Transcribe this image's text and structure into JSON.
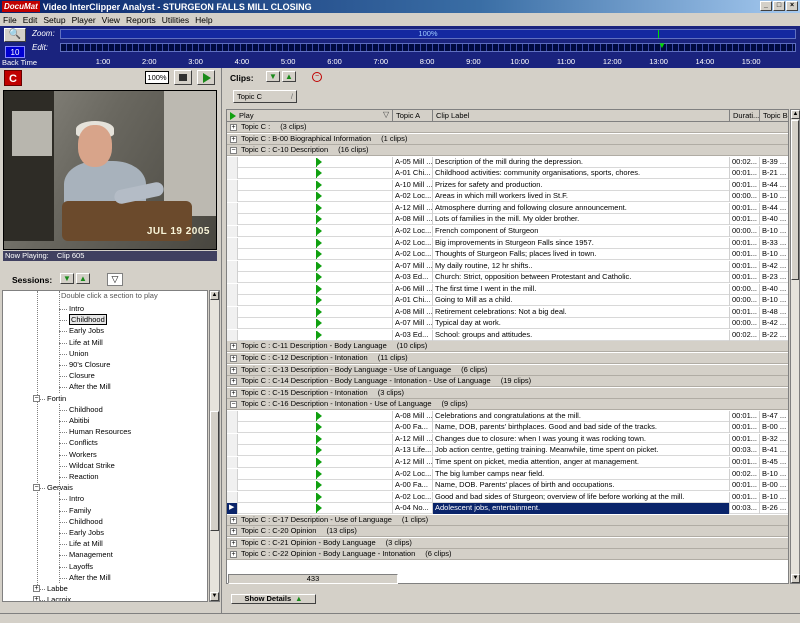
{
  "title_bar": {
    "logo": "DocuMat",
    "app": "Video InterClipper Analyst",
    "separator": "-",
    "document": "STURGEON FALLS MILL CLOSING",
    "controls": [
      "_",
      "□",
      "×"
    ]
  },
  "menu": [
    "File",
    "Edit",
    "Setup",
    "Player",
    "View",
    "Reports",
    "Utilities",
    "Help"
  ],
  "timeline": {
    "zoom_label": "Zoom:",
    "edit_label": "Edit:",
    "zoom_value": "100%",
    "back_time_value": "10",
    "back_time_label": "Back Time",
    "ticks": [
      "1:00",
      "2:00",
      "3:00",
      "4:00",
      "5:00",
      "6:00",
      "7:00",
      "8:00",
      "9:00",
      "10:00",
      "11:00",
      "12:00",
      "13:00",
      "14:00",
      "15:00"
    ],
    "edit_position_minutes": 13.0
  },
  "player": {
    "zoom": "100%",
    "video_timestamp": "JUL 19 2005",
    "now_playing_label": "Now Playing:",
    "now_playing_value": "Clip 605"
  },
  "sessions": {
    "label": "Sessions:",
    "hint": "Double click a section to play",
    "tree": [
      {
        "label": "Intro",
        "level": 2
      },
      {
        "label": "Childhood",
        "level": 2,
        "selected": true
      },
      {
        "label": "Early Jobs",
        "level": 2
      },
      {
        "label": "Life at Mill",
        "level": 2
      },
      {
        "label": "Union",
        "level": 2
      },
      {
        "label": "90's Closure",
        "level": 2
      },
      {
        "label": "Closure",
        "level": 2
      },
      {
        "label": "After the Mill",
        "level": 2
      },
      {
        "label": "Fortin",
        "level": 1,
        "expanded": true
      },
      {
        "label": "Childhood",
        "level": 2
      },
      {
        "label": "Abitibi",
        "level": 2
      },
      {
        "label": "Human Resources",
        "level": 2
      },
      {
        "label": "Conflicts",
        "level": 2
      },
      {
        "label": "Workers",
        "level": 2
      },
      {
        "label": "Wildcat Strike",
        "level": 2
      },
      {
        "label": "Reaction",
        "level": 2
      },
      {
        "label": "Gervais",
        "level": 1,
        "expanded": true
      },
      {
        "label": "Intro",
        "level": 2
      },
      {
        "label": "Family",
        "level": 2
      },
      {
        "label": "Childhood",
        "level": 2
      },
      {
        "label": "Early Jobs",
        "level": 2
      },
      {
        "label": "Life at Mill",
        "level": 2
      },
      {
        "label": "Management",
        "level": 2
      },
      {
        "label": "Layoffs",
        "level": 2
      },
      {
        "label": "After the Mill",
        "level": 2
      },
      {
        "label": "Labbe",
        "level": 1,
        "expanded": false
      },
      {
        "label": "Lacroix",
        "level": 1,
        "expanded": false
      }
    ]
  },
  "clips": {
    "label": "Clips:",
    "group_by": "Topic C",
    "columns": [
      "Play",
      "Topic A",
      "Clip Label",
      "Durati...",
      "Topic B"
    ],
    "rows": [
      {
        "type": "group",
        "text": "Topic C :",
        "count": "(3 clips)",
        "expanded": false
      },
      {
        "type": "group",
        "text": "Topic C : B-00 Biographical Information",
        "count": "(1 clips)",
        "expanded": false
      },
      {
        "type": "group",
        "text": "Topic C : C-10 Description",
        "count": "(16 clips)",
        "expanded": true
      },
      {
        "type": "clip",
        "topic_a": "A-05 Mill ...",
        "label": "Description of the mill during the depression.",
        "dur": "00:02...",
        "topic_b": "B-39 ..."
      },
      {
        "type": "clip",
        "topic_a": "A-01 Chi...",
        "label": "Childhood activities: community organisations, sports, chores.",
        "dur": "00:01...",
        "topic_b": "B-21 ..."
      },
      {
        "type": "clip",
        "topic_a": "A-10 Mill ...",
        "label": "Prizes for safety and production.",
        "dur": "00:01...",
        "topic_b": "B-44 ..."
      },
      {
        "type": "clip",
        "topic_a": "A-02 Loc...",
        "label": "Areas in which mill workers lived in St.F.",
        "dur": "00:00...",
        "topic_b": "B-10 ..."
      },
      {
        "type": "clip",
        "topic_a": "A-12 Mill ...",
        "label": "Atmosphere durring and following closure announcement.",
        "dur": "00:01...",
        "topic_b": "B-44 ..."
      },
      {
        "type": "clip",
        "topic_a": "A-08 Mill ...",
        "label": "Lots of families in the mill. My older brother.",
        "dur": "00:01...",
        "topic_b": "B-40 ..."
      },
      {
        "type": "clip",
        "topic_a": "A-02 Loc...",
        "label": "French component of Sturgeon",
        "dur": "00:00...",
        "topic_b": "B-10 ..."
      },
      {
        "type": "clip",
        "topic_a": "A-02 Loc...",
        "label": "Big improvements in Sturgeon Falls since 1957.",
        "dur": "00:01...",
        "topic_b": "B-33 ..."
      },
      {
        "type": "clip",
        "topic_a": "A-02 Loc...",
        "label": "Thoughts of Sturgeon Falls; places lived in town.",
        "dur": "00:01...",
        "topic_b": "B-10 ..."
      },
      {
        "type": "clip",
        "topic_a": "A-07 Mill ...",
        "label": "My daily routine, 12 hr shifts..",
        "dur": "00:01...",
        "topic_b": "B-42 ..."
      },
      {
        "type": "clip",
        "topic_a": "A-03 Ed...",
        "label": "Church: Strict, opposition between Protestant and Catholic.",
        "dur": "00:01...",
        "topic_b": "B-23 ..."
      },
      {
        "type": "clip",
        "topic_a": "A-06 Mill ...",
        "label": "The first time I went in the mill.",
        "dur": "00:00...",
        "topic_b": "B-40 ..."
      },
      {
        "type": "clip",
        "topic_a": "A-01 Chi...",
        "label": "Going to Mill as a child.",
        "dur": "00:00...",
        "topic_b": "B-10 ..."
      },
      {
        "type": "clip",
        "topic_a": "A-08 Mill ...",
        "label": "Retirement celebrations: Not a big deal.",
        "dur": "00:01...",
        "topic_b": "B-48 ..."
      },
      {
        "type": "clip",
        "topic_a": "A-07 Mill ...",
        "label": "Typical day at work.",
        "dur": "00:00...",
        "topic_b": "B-42 ..."
      },
      {
        "type": "clip",
        "topic_a": "A-03 Ed...",
        "label": "School: groups and attitudes.",
        "dur": "00:02...",
        "topic_b": "B-22 ..."
      },
      {
        "type": "group",
        "text": "Topic C : C-11 Description - Body Language",
        "count": "(10 clips)",
        "expanded": false
      },
      {
        "type": "group",
        "text": "Topic C : C-12 Description - Intonation",
        "count": "(11 clips)",
        "expanded": false
      },
      {
        "type": "group",
        "text": "Topic C : C-13 Description - Body Language - Use of Language",
        "count": "(6 clips)",
        "expanded": false
      },
      {
        "type": "group",
        "text": "Topic C : C-14 Description - Body Language - Intonation - Use of Language",
        "count": "(19 clips)",
        "expanded": false
      },
      {
        "type": "group",
        "text": "Topic C : C-15 Description - Intonation",
        "count": "(3 clips)",
        "expanded": false
      },
      {
        "type": "group",
        "text": "Topic C : C-16 Description - Intonation - Use of Language",
        "count": "(9 clips)",
        "expanded": true
      },
      {
        "type": "clip",
        "topic_a": "A-08 Mill ...",
        "label": "Celebrations and congratulations at the mill.",
        "dur": "00:01...",
        "topic_b": "B-47 ..."
      },
      {
        "type": "clip",
        "topic_a": "A-00 Fa...",
        "label": "Name, DOB, parents' birthplaces. Good and bad side of the tracks.",
        "dur": "00:01...",
        "topic_b": "B-00 ..."
      },
      {
        "type": "clip",
        "topic_a": "A-12 Mill ...",
        "label": "Changes due to closure: when I was young it was rocking town.",
        "dur": "00:01...",
        "topic_b": "B-32 ..."
      },
      {
        "type": "clip",
        "topic_a": "A-13 Life...",
        "label": "Job action centre, getting training. Meanwhile, time spent on picket.",
        "dur": "00:03...",
        "topic_b": "B-41 ..."
      },
      {
        "type": "clip",
        "topic_a": "A-12 Mill ...",
        "label": "Time spent on picket, media attention, anger at management.",
        "dur": "00:01...",
        "topic_b": "B-45 ..."
      },
      {
        "type": "clip",
        "topic_a": "A-02 Loc...",
        "label": "The big lumber camps near field.",
        "dur": "00:02...",
        "topic_b": "B-10 ..."
      },
      {
        "type": "clip",
        "topic_a": "A-00 Fa...",
        "label": "Name, DOB. Parents' places of birth and occupations.",
        "dur": "00:01...",
        "topic_b": "B-00 ..."
      },
      {
        "type": "clip",
        "topic_a": "A-02 Loc...",
        "label": "Good and bad sides of Sturgeon; overview of life before working at the mill.",
        "dur": "00:01...",
        "topic_b": "B-10 ..."
      },
      {
        "type": "clip",
        "topic_a": "A-04 No...",
        "label": "Adolescent jobs, entertainment.",
        "dur": "00:03...",
        "topic_b": "B-26 ...",
        "selected": true
      },
      {
        "type": "group",
        "text": "Topic C : C-17 Description - Use of Language",
        "count": "(1 clips)",
        "expanded": false
      },
      {
        "type": "group",
        "text": "Topic C : C-20 Opinion",
        "count": "(13 clips)",
        "expanded": false
      },
      {
        "type": "group",
        "text": "Topic C : C-21 Opinion - Body Language",
        "count": "(3 clips)",
        "expanded": false
      },
      {
        "type": "group",
        "text": "Topic C : C-22 Opinion - Body Language - Intonation",
        "count": "(6 clips)",
        "expanded": false
      }
    ],
    "total_count": "433",
    "show_details": "Show  Details"
  },
  "colors": {
    "title_start": "#0a246a",
    "timeline_bg": "#1a237e",
    "play_flag": "#10a010",
    "selection": "#0a246a",
    "brand_red": "#c00000"
  }
}
